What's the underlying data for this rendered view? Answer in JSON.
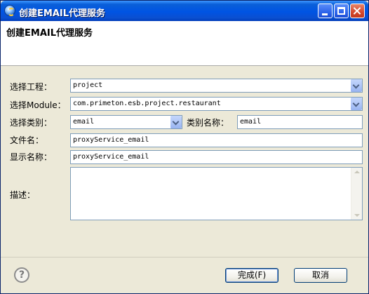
{
  "window": {
    "title": "创建EMAIL代理服务"
  },
  "banner": {
    "title": "创建EMAIL代理服务"
  },
  "form": {
    "project_label": "选择工程：",
    "project_value": "project",
    "module_label": "选择Module：",
    "module_value": "com.primeton.esb.project.restaurant",
    "type_label": "选择类别：",
    "type_value": "email",
    "type_name_label": "类别名称：",
    "type_name_value": "email",
    "filename_label": "文件名：",
    "filename_value": "proxyService_email",
    "display_name_label": "显示名称：",
    "display_name_value": "proxyService_email",
    "description_label": "描述：",
    "description_value": ""
  },
  "footer": {
    "help_icon": "?",
    "finish_label": "完成(F)",
    "cancel_label": "取消"
  },
  "colors": {
    "titlebar": "#0054e3",
    "accent_border": "#7f9db9",
    "dialog_bg": "#ece9d8"
  }
}
